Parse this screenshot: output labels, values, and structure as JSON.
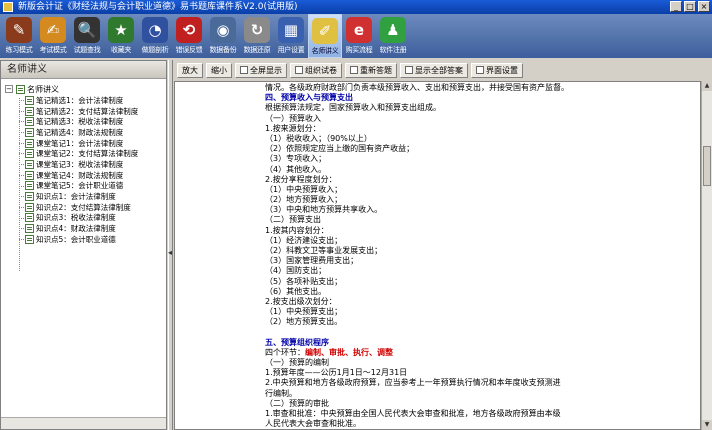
{
  "window": {
    "title": "新版会计证《财经法规与会计职业道德》易书题库课件系V2.0(试用版)",
    "buttons": [
      "_",
      "□",
      "×"
    ]
  },
  "toolbar": {
    "items": [
      {
        "label": "练习模式",
        "icon": "book-icon",
        "color": "#8a3b1c",
        "glyph": "✎"
      },
      {
        "label": "考试模式",
        "icon": "folder-icon",
        "color": "#d48a1f",
        "glyph": "✍"
      },
      {
        "label": "试题查找",
        "icon": "magnifier-icon",
        "color": "#333333",
        "glyph": "🔍"
      },
      {
        "label": "收藏夹",
        "icon": "bookmark-icon",
        "color": "#2f7a2f",
        "glyph": "★"
      },
      {
        "label": "做题剖析",
        "icon": "compass-icon",
        "color": "#3050a0",
        "glyph": "◔"
      },
      {
        "label": "错误反馈",
        "icon": "feedback-icon",
        "color": "#c02020",
        "glyph": "⟲"
      },
      {
        "label": "数据备份",
        "icon": "disk-icon",
        "color": "#4a6a9a",
        "glyph": "◉"
      },
      {
        "label": "数据还原",
        "icon": "restore-icon",
        "color": "#8a8a8a",
        "glyph": "↻"
      },
      {
        "label": "用户设置",
        "icon": "user-settings-icon",
        "color": "#3a60b0",
        "glyph": "▦"
      },
      {
        "label": "名师讲义",
        "icon": "notes-icon",
        "color": "#e0c040",
        "glyph": "✐",
        "active": true
      },
      {
        "label": "购买流程",
        "icon": "ie-browser-icon",
        "color": "#d03030",
        "glyph": "e"
      },
      {
        "label": "软件注册",
        "icon": "register-icon",
        "color": "#30a040",
        "glyph": "♟"
      }
    ]
  },
  "left_panel": {
    "title": "名师讲义",
    "root": "名师讲义",
    "items": [
      "笔记精选1：会计法律制度",
      "笔记精选2：支付结算法律制度",
      "笔记精选3：税收法律制度",
      "笔记精选4：财政法规制度",
      "课堂笔记1：会计法律制度",
      "课堂笔记2：支付结算法律制度",
      "课堂笔记3：税收法律制度",
      "课堂笔记4：财政法规制度",
      "课堂笔记5：会计职业道德",
      "知识点1：会计法律制度",
      "知识点2：支付结算法律制度",
      "知识点3：税收法律制度",
      "知识点4：财政法律制度",
      "知识点5：会计职业道德"
    ]
  },
  "right_toolbar": {
    "buttons": [
      "放大",
      "缩小",
      "全屏显示",
      "组织试卷",
      "重新答题",
      "显示全部答案",
      "界面设置"
    ]
  },
  "content": {
    "lines": [
      {
        "t": "情况。各级政府财政部门负责本级预算收入、支出和预算支出，并接受国有资产监督。",
        "c": ""
      },
      {
        "t": "四、预算收入与预算支出",
        "c": "h"
      },
      {
        "t": "根据预算法规定，国家预算收入和预算支出组成。",
        "c": ""
      },
      {
        "t": "（一）预算收入",
        "c": ""
      },
      {
        "t": "1.按来源划分：",
        "c": ""
      },
      {
        "t": "（1）税收收入；（90%以上）",
        "c": ""
      },
      {
        "t": "（2）依照规定应当上缴的国有资产收益；",
        "c": ""
      },
      {
        "t": "（3）专项收入；",
        "c": ""
      },
      {
        "t": "（4）其他收入。",
        "c": ""
      },
      {
        "t": "2.按分享程度划分：",
        "c": ""
      },
      {
        "t": "（1）中央预算收入；",
        "c": ""
      },
      {
        "t": "（2）地方预算收入；",
        "c": ""
      },
      {
        "t": "（3）中央和地方预算共享收入。",
        "c": ""
      },
      {
        "t": "（二）预算支出",
        "c": ""
      },
      {
        "t": "1.按其内容划分：",
        "c": ""
      },
      {
        "t": "（1）经济建设支出；",
        "c": ""
      },
      {
        "t": "（2）科教文卫等事业发展支出；",
        "c": ""
      },
      {
        "t": "（3）国家管理费用支出；",
        "c": ""
      },
      {
        "t": "（4）国防支出；",
        "c": ""
      },
      {
        "t": "（5）各项补贴支出；",
        "c": ""
      },
      {
        "t": "（6）其他支出。",
        "c": ""
      },
      {
        "t": "2.按支出级次划分：",
        "c": ""
      },
      {
        "t": "（1）中央预算支出；",
        "c": ""
      },
      {
        "t": "（2）地方预算支出。",
        "c": ""
      },
      {
        "t": "",
        "c": ""
      },
      {
        "t": "五、预算组织程序",
        "c": "h"
      },
      {
        "t": "四个环节：",
        "c": "",
        "red": "编制、审批、执行、调整"
      },
      {
        "t": "（一）预算的编制",
        "c": ""
      },
      {
        "t": "1.预算年度——公历1月1日～12月31日",
        "c": ""
      },
      {
        "t": "2.中央预算和地方各级政府预算，应当参考上一年预算执行情况和本年度收支预测进",
        "c": ""
      },
      {
        "t": "行编制。",
        "c": ""
      },
      {
        "t": "（二）预算的审批",
        "c": ""
      },
      {
        "t": "1.审查和批准：中央预算由全国人民代表大会审查和批准，地方各级政府预算由本级",
        "c": ""
      },
      {
        "t": "人民代表大会审查和批准。",
        "c": ""
      }
    ]
  }
}
